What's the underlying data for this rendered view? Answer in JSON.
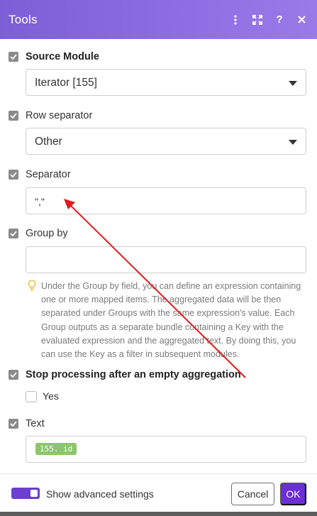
{
  "dialog": {
    "title": "Tools",
    "header_icons": [
      "more-vertical-icon",
      "expand-icon",
      "help-icon",
      "close-icon"
    ],
    "header_help": "?"
  },
  "fields": {
    "source_module": {
      "label": "Source Module",
      "value": "Iterator [155]"
    },
    "row_separator": {
      "label": "Row separator",
      "value": "Other"
    },
    "separator": {
      "label": "Separator",
      "value": "\",\""
    },
    "group_by": {
      "label": "Group by",
      "value": "",
      "hint": "Under the Group by field, you can define an expression containing one or more mapped items. The aggregated data will be then separated under Groups with the same expression's value. Each Group outputs as a separate bundle containing a Key with the evaluated expression and the aggregated text. By doing this, you can use the Key as a filter in subsequent modules."
    },
    "stop_processing": {
      "label": "Stop processing after an empty aggregation",
      "option_label": "Yes",
      "checked": false
    },
    "text": {
      "label": "Text",
      "token": "155. id"
    }
  },
  "footer": {
    "advanced_label": "Show advanced settings",
    "advanced_enabled": true,
    "cancel_label": "Cancel",
    "ok_label": "OK"
  },
  "colors": {
    "header": "#8f6ee3",
    "primary": "#6b2fd3",
    "token": "#8bc66a",
    "annotation_arrow": "#e01b1b"
  }
}
